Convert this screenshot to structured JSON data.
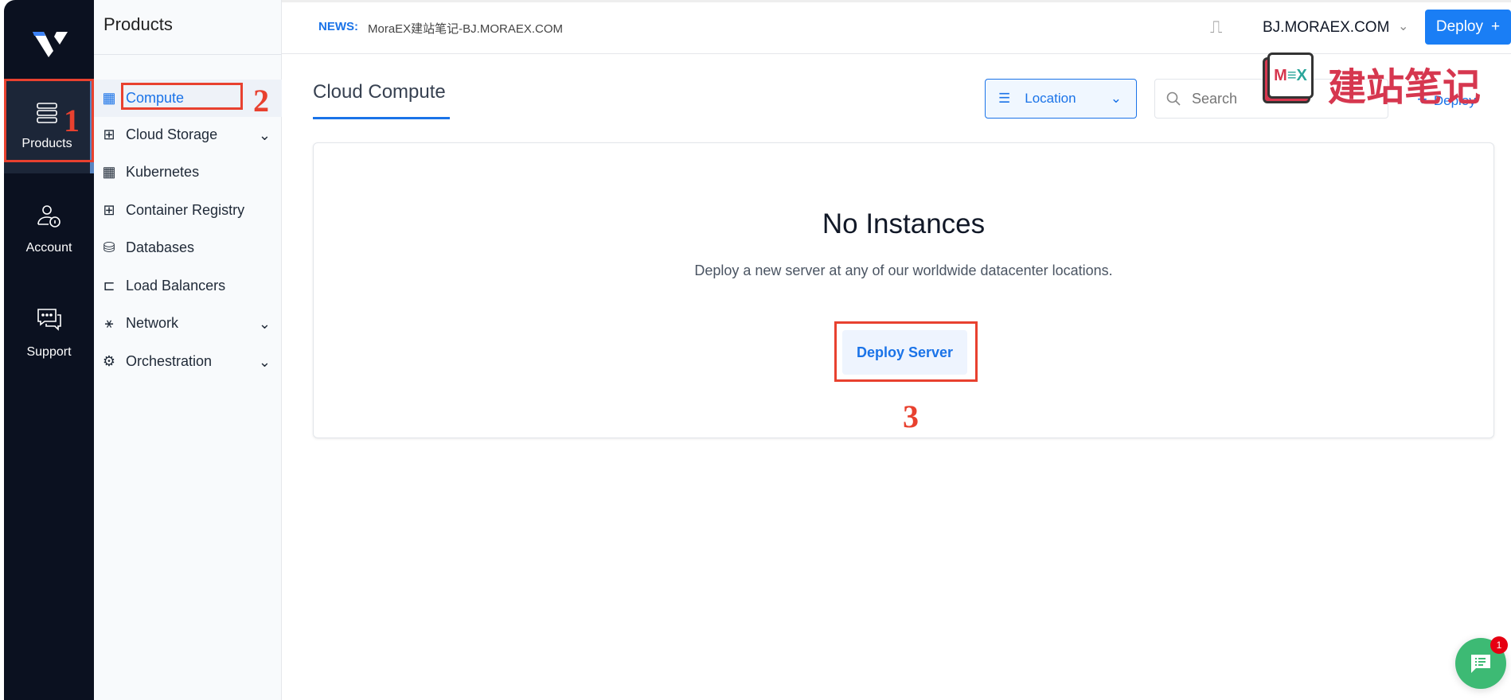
{
  "rail": {
    "items": [
      {
        "label": "Products",
        "icon": "server-stack-icon",
        "active": true
      },
      {
        "label": "Account",
        "icon": "user-lock-icon"
      },
      {
        "label": "Support",
        "icon": "chat-icon"
      }
    ]
  },
  "panel": {
    "title": "Products",
    "items": [
      {
        "label": "Compute",
        "active": true,
        "expandable": false
      },
      {
        "label": "Cloud Storage",
        "expandable": true
      },
      {
        "label": "Kubernetes",
        "expandable": false
      },
      {
        "label": "Container Registry",
        "expandable": false
      },
      {
        "label": "Databases",
        "expandable": false
      },
      {
        "label": "Load Balancers",
        "expandable": false
      },
      {
        "label": "Network",
        "expandable": true
      },
      {
        "label": "Orchestration",
        "expandable": true
      }
    ]
  },
  "header": {
    "news_label": "NEWS:",
    "news_text": "MoraEX建站笔记-BJ.MORAEX.COM",
    "account": "BJ.MORAEX.COM",
    "deploy_label": "Deploy"
  },
  "main": {
    "tab": "Cloud Compute",
    "location_label": "Location",
    "search_placeholder": "Search",
    "deploy_link": "Deploy"
  },
  "empty": {
    "title": "No Instances",
    "subtitle": "Deploy a new server at any of our worldwide datacenter locations.",
    "button": "Deploy Server"
  },
  "annotations": [
    "1",
    "2",
    "3"
  ],
  "watermark": {
    "logo": "MEX",
    "text": "建站笔记"
  },
  "chat": {
    "badge": "1"
  },
  "colors": {
    "accent": "#1a73e8",
    "rail": "#0b1120",
    "annotation": "#e8412f",
    "chat": "#3dba74",
    "watermark": "#d6374f"
  }
}
